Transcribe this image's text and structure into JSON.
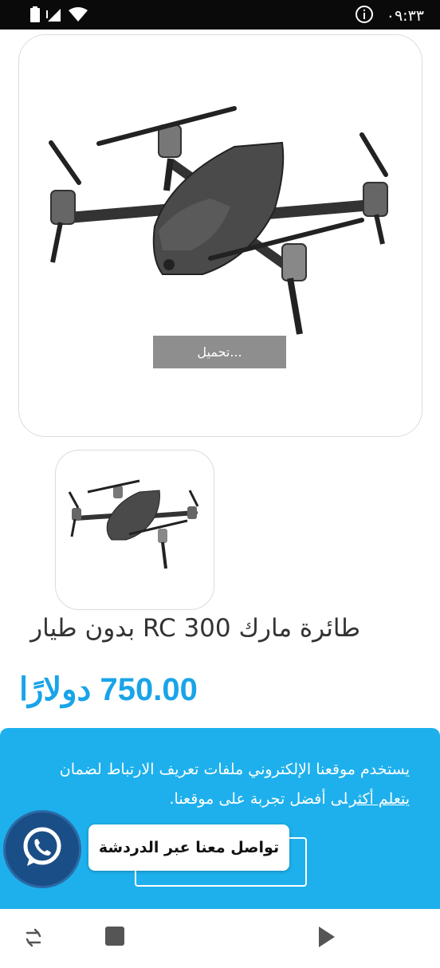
{
  "status_bar": {
    "time": "٠٩:٣٣",
    "icons": [
      "battery-icon",
      "signal-icon",
      "wifi-icon",
      "info-icon"
    ]
  },
  "product": {
    "image_loading_label": "تحميل...",
    "title": "طائرة مارك RC 300 بدون طيار",
    "price": "750.00 دولارًا"
  },
  "cookie_banner": {
    "text_before_link": "يستخدم موقعنا الإلكتروني ملفات تعريف الارتباط لضمان حصولك على أفضل تجربة على موقعنا.",
    "learn_more": "يتعلم أكثر",
    "accept_label": ""
  },
  "chat": {
    "bubble_label": "تواصل معنا عبر الدردشة",
    "icon": "whatsapp-icon"
  },
  "nav": {
    "icons": [
      "rotate-icon",
      "stop-icon",
      "play-icon"
    ]
  },
  "colors": {
    "accent": "#1aa4e8",
    "banner": "#1eb0ec",
    "chat": "#1a4e86"
  }
}
